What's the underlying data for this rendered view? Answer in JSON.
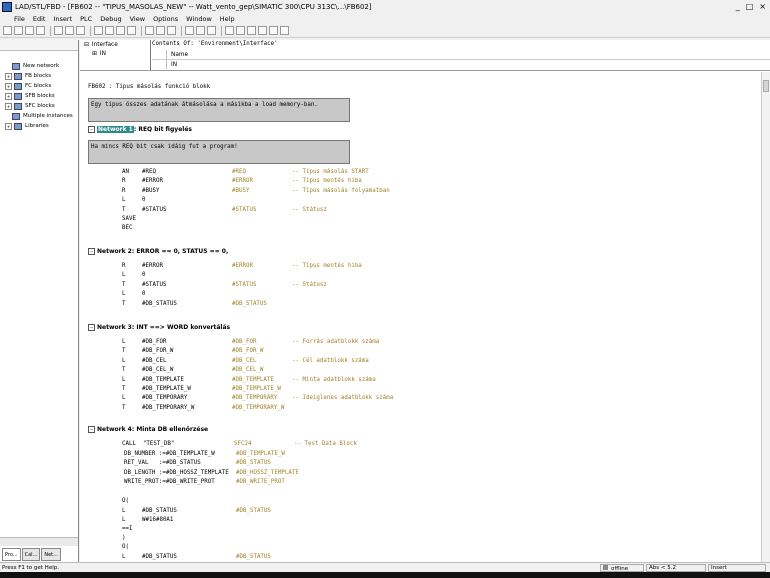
{
  "window": {
    "title": "LAD/STL/FBD - [FB602 -- \"TIPUS_MASOLAS_NEW\" -- Watt_vento_gep\\SIMATIC 300\\CPU 313C\\...\\FB602]",
    "buttons": [
      "_",
      "□",
      "×"
    ]
  },
  "menu": [
    "File",
    "Edit",
    "Insert",
    "PLC",
    "Debug",
    "View",
    "Options",
    "Window",
    "Help"
  ],
  "tree": [
    {
      "label": "New network",
      "exp": ""
    },
    {
      "label": "FB blocks",
      "exp": "+"
    },
    {
      "label": "FC blocks",
      "exp": "+"
    },
    {
      "label": "SFB blocks",
      "exp": "+"
    },
    {
      "label": "SFC blocks",
      "exp": "+"
    },
    {
      "label": "Multiple instances",
      "exp": ""
    },
    {
      "label": "Libraries",
      "exp": "+"
    }
  ],
  "tabs": [
    "Pro...",
    "Cal...",
    "Net..."
  ],
  "interface": {
    "left_rows": [
      "Interface",
      "IN"
    ],
    "contents_title": "Contents Of: 'Environment\\Interface'",
    "col_header": "Name",
    "row": "IN"
  },
  "block_title": "FB602 : Tipus másolás funkció blokk",
  "block_comment": "Egy tipus összes adatának átmásolása a másikba a load memory-ban.",
  "networks": [
    {
      "num": "Network 1",
      "title": ": REQ bit figyelés",
      "comment": "Ha mincs REQ bit csak idáig fut a program!"
    },
    {
      "num": "Network 2",
      "title": ": ERROR == 0, STATUS == 0,"
    },
    {
      "num": "Network 3",
      "title": ": INT ==> WORD konvertálás"
    },
    {
      "num": "Network 4",
      "title": ": Minta DB ellenőrzése"
    }
  ],
  "code_lines": [
    {
      "op": "AN",
      "arg": "#REQ",
      "sym": "#REQ",
      "cmt": "-- Típus másolás START"
    },
    {
      "op": "R",
      "arg": "#ERROR",
      "sym": "#ERROR",
      "cmt": "-- Típus mentés hiba"
    },
    {
      "op": "R",
      "arg": "#BUSY",
      "sym": "#BUSY",
      "cmt": "-- Típus másolás folyamatban"
    },
    {
      "op": "L",
      "arg": "0",
      "sym": "",
      "cmt": ""
    },
    {
      "op": "T",
      "arg": "#STATUS",
      "sym": "#STATUS",
      "cmt": "-- Státusz"
    },
    {
      "op": "SAVE",
      "arg": "",
      "sym": "",
      "cmt": ""
    },
    {
      "op": "BEC",
      "arg": "",
      "sym": "",
      "cmt": ""
    },
    {
      "op": "R",
      "arg": "#ERROR",
      "sym": "#ERROR",
      "cmt": "-- Típus mentés hiba"
    },
    {
      "op": "L",
      "arg": "0",
      "sym": "",
      "cmt": ""
    },
    {
      "op": "T",
      "arg": "#STATUS",
      "sym": "#STATUS",
      "cmt": "-- Státusz"
    },
    {
      "op": "L",
      "arg": "0",
      "sym": "",
      "cmt": ""
    },
    {
      "op": "T",
      "arg": "#DB_STATUS",
      "sym": "#DB_STATUS",
      "cmt": ""
    },
    {
      "op": "L",
      "arg": "#DB_FOR",
      "sym": "#DB_FOR",
      "cmt": "-- Forrás adatblokk száma"
    },
    {
      "op": "T",
      "arg": "#DB_FOR_W",
      "sym": "#DB_FOR_W",
      "cmt": ""
    },
    {
      "op": "L",
      "arg": "#DB_CEL",
      "sym": "#DB_CEL",
      "cmt": "-- Cél adatblokk száma"
    },
    {
      "op": "T",
      "arg": "#DB_CEL_W",
      "sym": "#DB_CEL_W",
      "cmt": ""
    },
    {
      "op": "L",
      "arg": "#DB_TEMPLATE",
      "sym": "#DB_TEMPLATE",
      "cmt": "-- Minta adatblokk száma"
    },
    {
      "op": "T",
      "arg": "#DB_TEMPLATE_W",
      "sym": "#DB_TEMPLATE_W",
      "cmt": ""
    },
    {
      "op": "L",
      "arg": "#DB_TEMPORARY",
      "sym": "#DB_TEMPORARY",
      "cmt": "-- Ideiglenes adatblokk száma"
    },
    {
      "op": "T",
      "arg": "#DB_TEMPORARY_W",
      "sym": "#DB_TEMPORARY_W",
      "cmt": ""
    }
  ],
  "call_block": {
    "call": "CALL  \"TEST_DB\"",
    "call_sym": "SFC24",
    "call_cmt": "-- Test Data Block",
    "params": [
      {
        "p": "DB_NUMBER :=#DB_TEMPLATE_W",
        "s": "#DB_TEMPLATE_W"
      },
      {
        "p": "RET_VAL   :=#DB_STATUS",
        "s": "#DB_STATUS"
      },
      {
        "p": "DB_LENGTH :=#DB_HOSSZ_TEMPLATE",
        "s": "#DB_HOSSZ_TEMPLATE"
      },
      {
        "p": "WRITE_PROT:=#DB_WRITE_PROT",
        "s": "#DB_WRITE_PROT"
      }
    ]
  },
  "tail_lines": [
    {
      "op": "O(",
      "arg": "",
      "sym": ""
    },
    {
      "op": "L",
      "arg": "#DB_STATUS",
      "sym": "#DB_STATUS"
    },
    {
      "op": "L",
      "arg": "W#16#80A1",
      "sym": ""
    },
    {
      "op": "==I",
      "arg": "",
      "sym": ""
    },
    {
      "op": ")",
      "arg": "",
      "sym": ""
    },
    {
      "op": "O(",
      "arg": "",
      "sym": ""
    },
    {
      "op": "L",
      "arg": "#DB_STATUS",
      "sym": "#DB_STATUS"
    }
  ],
  "status": {
    "hint": "Press F1 to get Help.",
    "mode": "offline",
    "pos": "Abs < 5.2",
    "insert": "Insert"
  }
}
